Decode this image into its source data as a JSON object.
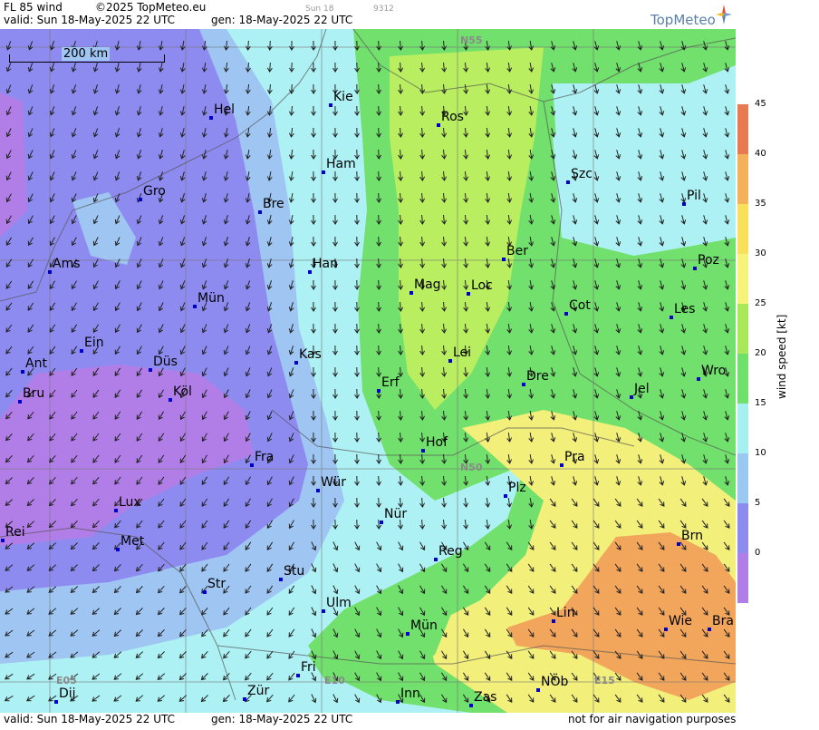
{
  "header": {
    "product": "FL 85 wind",
    "copyright": "©2025 TopMeteo.eu",
    "valid": "valid:  Sun  18-May-2025  22 UTC",
    "generated": "gen: 18-May-2025 22 UTC",
    "sun": "Sun 18",
    "code": "9312",
    "brand": "TopMeteo"
  },
  "footer": {
    "valid": "valid:  Sun  18-May-2025  22 UTC",
    "generated": "gen: 18-May-2025 22 UTC",
    "disclaimer": "not for air navigation purposes"
  },
  "scale_bar": "200 km",
  "grid_labels": [
    {
      "name": "n55",
      "text": "N55"
    },
    {
      "name": "n50",
      "text": "N50"
    },
    {
      "name": "e05",
      "text": "E05"
    },
    {
      "name": "e10",
      "text": "E10"
    },
    {
      "name": "e15",
      "text": "E15"
    }
  ],
  "cities": [
    "Hel",
    "Kie",
    "Ros",
    "Ham",
    "Szc",
    "Pil",
    "Gro",
    "Bre",
    "Ber",
    "Poz",
    "Ams",
    "Han",
    "Mag",
    "Loc",
    "Cot",
    "Les",
    "Mün",
    "Ein",
    "Kas",
    "Lei",
    "Wro",
    "Ant",
    "Düs",
    "Erf",
    "Dre",
    "Jel",
    "Bru",
    "Köl",
    "Hof",
    "Fra",
    "Pra",
    "Wür",
    "Plz",
    "Lux",
    "Nür",
    "Rei",
    "Met",
    "Reg",
    "Stu",
    "Str",
    "Brn",
    "Ulm",
    "Lin",
    "Wie",
    "Bra",
    "Mün",
    "Fri",
    "NÖb",
    "Dij",
    "Zür",
    "Inn",
    "Zas"
  ],
  "legend": {
    "title": "wind speed [kt]",
    "ticks": [
      "45",
      "40",
      "35",
      "30",
      "25",
      "20",
      "15",
      "10",
      "5",
      "0"
    ],
    "colors": [
      "#e87a52",
      "#f4b15a",
      "#f8e05a",
      "#f6f27a",
      "#a9e858",
      "#6fe06a",
      "#a6f0f2",
      "#99c8f0",
      "#8d8cee",
      "#b07ee6"
    ]
  },
  "colors": {
    "purple": "#b17ee8",
    "violet": "#8e8bf0",
    "lightblue": "#9fc6f2",
    "cyan": "#aef1f4",
    "green": "#71e06c",
    "yellowgreen": "#b8ee60",
    "yellow": "#f2ef7a",
    "orange": "#f2a65c"
  }
}
